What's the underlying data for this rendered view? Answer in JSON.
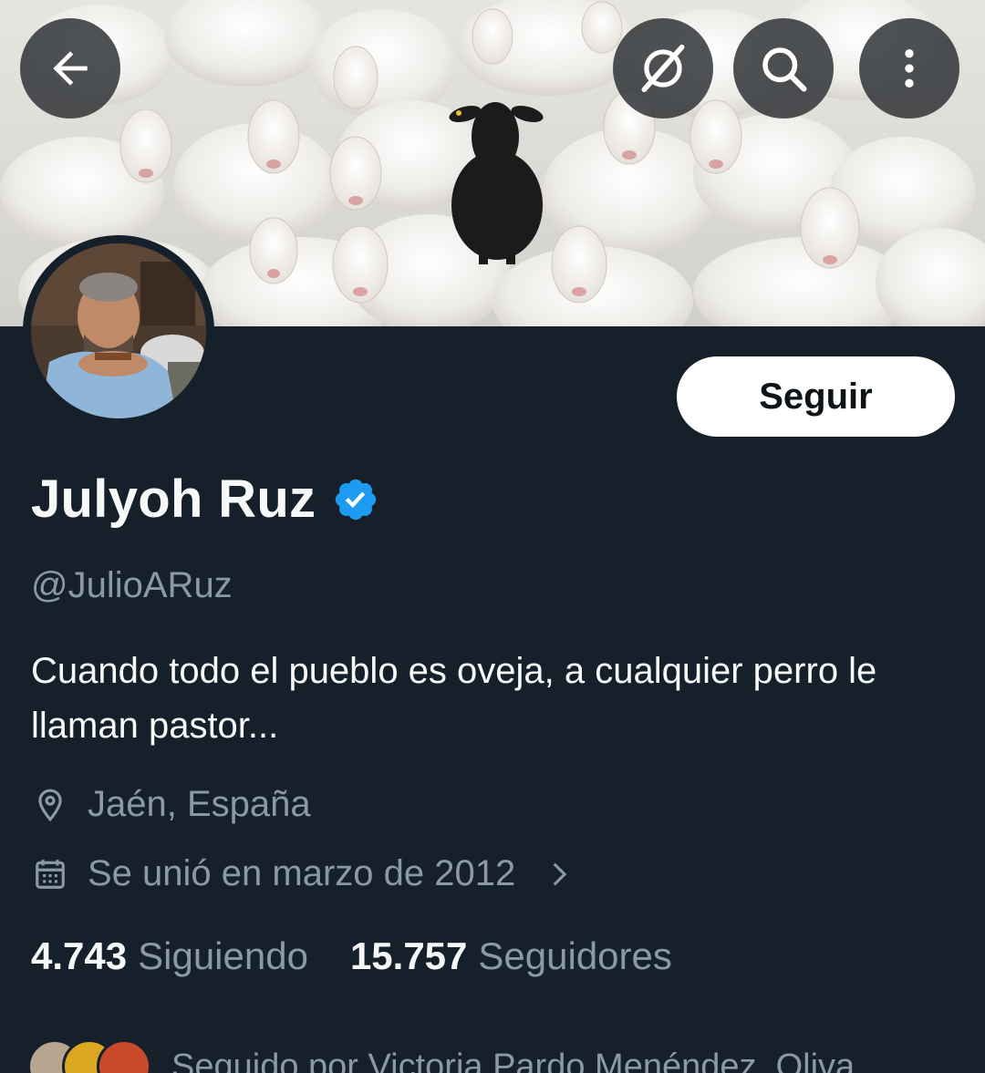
{
  "header": {
    "back_icon": "arrow-left-icon",
    "grok_icon": "grok-icon",
    "search_icon": "search-icon",
    "more_icon": "more-vertical-icon"
  },
  "profile": {
    "display_name": "Julyoh Ruz",
    "verified": true,
    "verified_color": "#1d9bf0",
    "handle": "@JulioARuz",
    "bio": "Cuando todo el pueblo es oveja, a cualquier perro le llaman pastor...",
    "location": "Jaén, España",
    "joined": "Se unió en marzo de 2012",
    "follow_label": "Seguir"
  },
  "stats": {
    "following_count": "4.743",
    "following_label": "Siguiendo",
    "followers_count": "15.757",
    "followers_label": "Seguidores"
  },
  "followed_by": {
    "text": "Seguido por Victoria Pardo Menéndez, Oliva,"
  },
  "colors": {
    "background": "#15202b",
    "muted_text": "#8b98a5",
    "primary_text": "#f7f9f9"
  }
}
